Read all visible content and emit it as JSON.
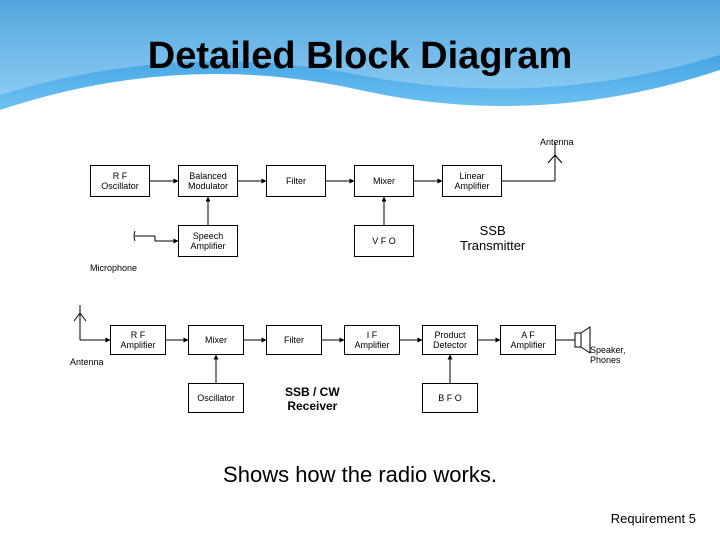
{
  "slide": {
    "title": "Detailed Block Diagram",
    "caption": "Shows how the radio works.",
    "footer": "Requirement  5"
  },
  "transmitter": {
    "blocks": {
      "rf_osc": "R F\nOscillator",
      "bal_mod": "Balanced\nModulator",
      "filter": "Filter",
      "mixer": "Mixer",
      "lin_amp": "Linear\nAmplifier",
      "speech_amp": "Speech\nAmplifier",
      "vfo": "V F O"
    },
    "labels": {
      "antenna": "Antenna",
      "microphone": "Microphone",
      "title": "SSB\nTransmitter"
    }
  },
  "receiver": {
    "blocks": {
      "rf_amp": "R F\nAmplifier",
      "mixer": "Mixer",
      "filter": "Filter",
      "if_amp": "I F\nAmplifier",
      "prod_det": "Product\nDetector",
      "af_amp": "A F\nAmplifier",
      "osc": "Oscillator",
      "bfo": "B F O"
    },
    "labels": {
      "antenna": "Antenna",
      "speaker": "Speaker,\nPhones",
      "title": "SSB / CW\nReceiver"
    }
  }
}
